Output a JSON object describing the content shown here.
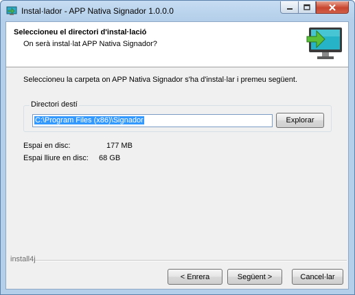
{
  "window": {
    "title": "Instal·lador - APP Nativa Signador 1.0.0.0"
  },
  "header": {
    "title": "Seleccioneu el directori d'instal·lació",
    "subtitle": "On serà instal·lat APP Nativa Signador?",
    "image_icon": "monitor-install-icon"
  },
  "main": {
    "intro": "Seleccioneu la carpeta on APP Nativa Signador s'ha d'instal·lar i premeu següent.",
    "destination": {
      "legend": "Directori destí",
      "path": "C:\\Program Files (x86)\\Signador",
      "browse_label": "Explorar"
    },
    "disk_required_label": "Espai en disc:",
    "disk_required_value": "177 MB",
    "disk_free_label": "Espai lliure en disc:",
    "disk_free_value": "68 GB"
  },
  "footer": {
    "brand": "install4j",
    "back_label": "< Enrera",
    "next_label": "Següent >",
    "cancel_label": "Cancel·lar"
  },
  "colors": {
    "accent_arrow": "#4caf50",
    "monitor_screen": "#2bb7c9",
    "selection": "#3399ff"
  }
}
